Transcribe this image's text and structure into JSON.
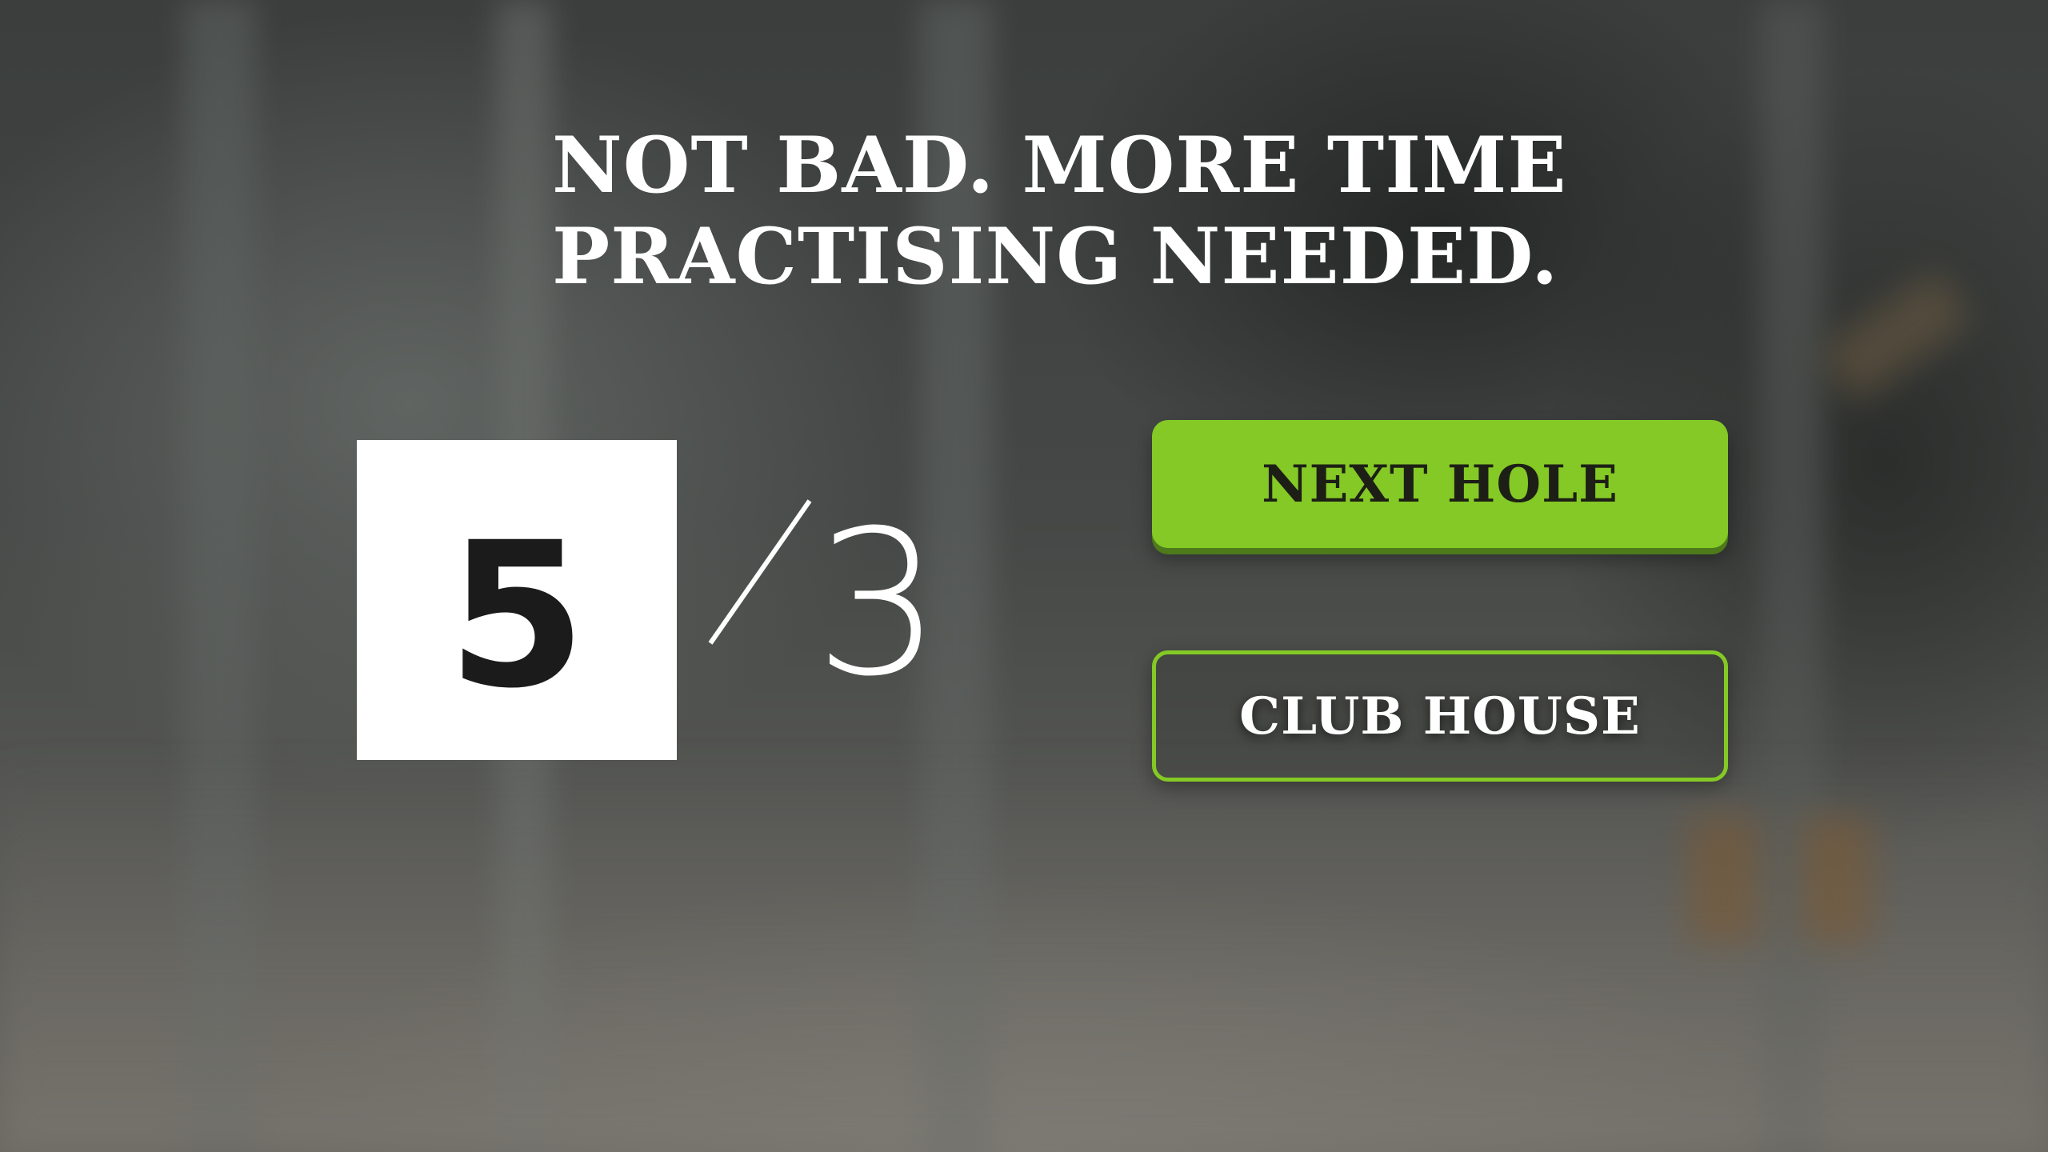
{
  "screen": {
    "message_line1": "NOT BAD. MORE TIME",
    "message_line2": "PRACTISING NEEDED."
  },
  "score": {
    "strokes": "5",
    "par": "3"
  },
  "buttons": {
    "next_hole_label": "NEXT HOLE",
    "club_house_label": "CLUB HOUSE"
  },
  "colors": {
    "accent_green": "#84c925",
    "score_box": "#ffffff",
    "score_text": "#1c1b1b"
  }
}
